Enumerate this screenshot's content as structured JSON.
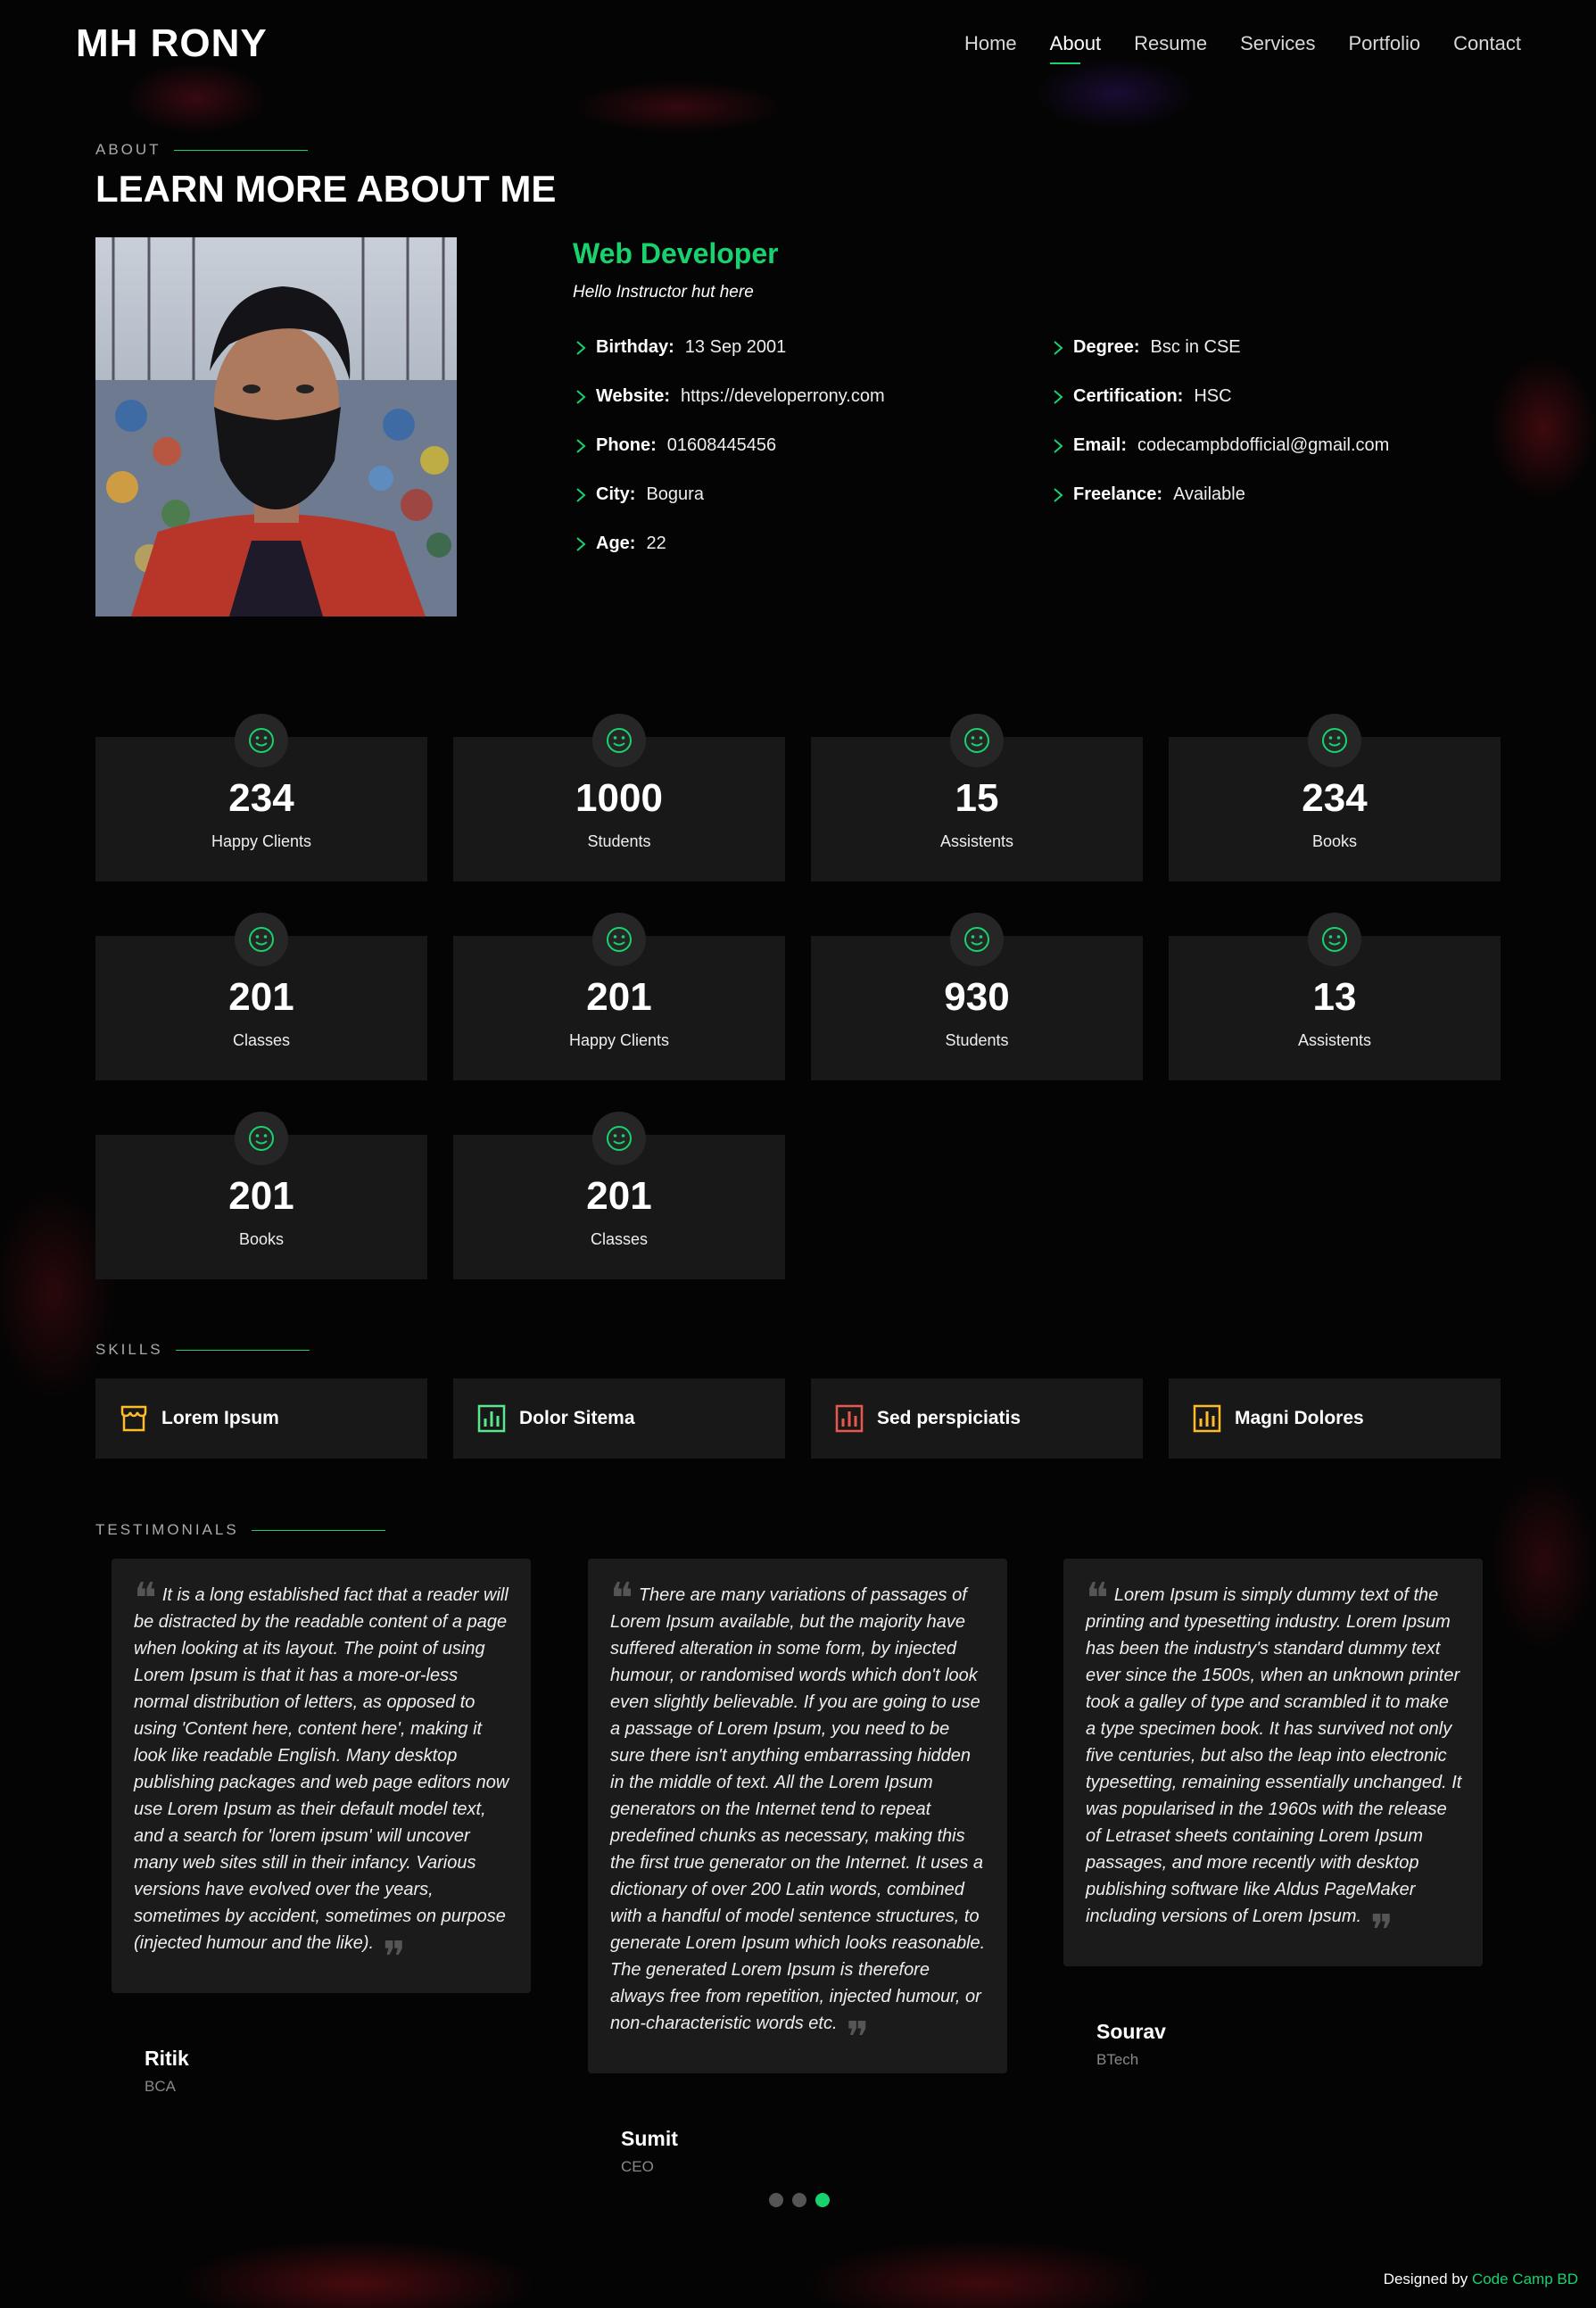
{
  "header": {
    "logo": "MH RONY",
    "nav": [
      "Home",
      "About",
      "Resume",
      "Services",
      "Portfolio",
      "Contact"
    ],
    "active": "About"
  },
  "about": {
    "label": "ABOUT",
    "title": "LEARN MORE ABOUT ME",
    "role": "Web Developer",
    "intro": "Hello Instructor hut here",
    "left": [
      {
        "k": "Birthday:",
        "v": "13 Sep 2001"
      },
      {
        "k": "Website:",
        "v": "https://developerrony.com"
      },
      {
        "k": "Phone:",
        "v": "01608445456"
      },
      {
        "k": "City:",
        "v": "Bogura"
      },
      {
        "k": "Age:",
        "v": "22"
      }
    ],
    "right": [
      {
        "k": "Degree:",
        "v": "Bsc in CSE"
      },
      {
        "k": "Certification:",
        "v": "HSC"
      },
      {
        "k": "Email:",
        "v": "codecampbdofficial@gmail.com"
      },
      {
        "k": "Freelance:",
        "v": "Available"
      }
    ]
  },
  "counts": [
    {
      "num": "234",
      "label": "Happy Clients"
    },
    {
      "num": "1000",
      "label": "Students"
    },
    {
      "num": "15",
      "label": "Assistents"
    },
    {
      "num": "234",
      "label": "Books"
    },
    {
      "num": "201",
      "label": "Classes"
    },
    {
      "num": "201",
      "label": "Happy Clients"
    },
    {
      "num": "930",
      "label": "Students"
    },
    {
      "num": "13",
      "label": "Assistents"
    },
    {
      "num": "201",
      "label": "Books"
    },
    {
      "num": "201",
      "label": "Classes"
    }
  ],
  "skills": {
    "label": "SKILLS",
    "items": [
      {
        "name": "Lorem Ipsum",
        "icon": "store-icon",
        "color": "#ffbb2c"
      },
      {
        "name": "Dolor Sitema",
        "icon": "bar-chart-icon",
        "color": "#5be88c"
      },
      {
        "name": "Sed perspiciatis",
        "icon": "bar-chart-icon",
        "color": "#e361ff"
      },
      {
        "name": "Magni Dolores",
        "icon": "bar-chart-icon",
        "color": "#ffbb2c"
      }
    ]
  },
  "testimonials": {
    "label": "TESTIMONIALS",
    "items": [
      {
        "text": "It is a long established fact that a reader will be distracted by the readable content of a page when looking at its layout. The point of using Lorem Ipsum is that it has a more-or-less normal distribution of letters, as opposed to using 'Content here, content here', making it look like readable English. Many desktop publishing packages and web page editors now use Lorem Ipsum as their default model text, and a search for 'lorem ipsum' will uncover many web sites still in their infancy. Various versions have evolved over the years, sometimes by accident, sometimes on purpose (injected humour and the like).",
        "name": "Ritik",
        "role": "BCA"
      },
      {
        "text": "There are many variations of passages of Lorem Ipsum available, but the majority have suffered alteration in some form, by injected humour, or randomised words which don't look even slightly believable. If you are going to use a passage of Lorem Ipsum, you need to be sure there isn't anything embarrassing hidden in the middle of text. All the Lorem Ipsum generators on the Internet tend to repeat predefined chunks as necessary, making this the first true generator on the Internet. It uses a dictionary of over 200 Latin words, combined with a handful of model sentence structures, to generate Lorem Ipsum which looks reasonable. The generated Lorem Ipsum is therefore always free from repetition, injected humour, or non-characteristic words etc.",
        "name": "Sumit",
        "role": "CEO"
      },
      {
        "text": "Lorem Ipsum is simply dummy text of the printing and typesetting industry. Lorem Ipsum has been the industry's standard dummy text ever since the 1500s, when an unknown printer took a galley of type and scrambled it to make a type specimen book. It has survived not only five centuries, but also the leap into electronic typesetting, remaining essentially unchanged. It was popularised in the 1960s with the release of Letraset sheets containing Lorem Ipsum passages, and more recently with desktop publishing software like Aldus PageMaker including versions of Lorem Ipsum.",
        "name": "Sourav",
        "role": "BTech"
      }
    ]
  },
  "footer": {
    "prefix": "Designed by ",
    "brand": "Code Camp BD"
  },
  "colors": {
    "accent": "#18d26e",
    "card": "#181818",
    "background": "#040404"
  }
}
